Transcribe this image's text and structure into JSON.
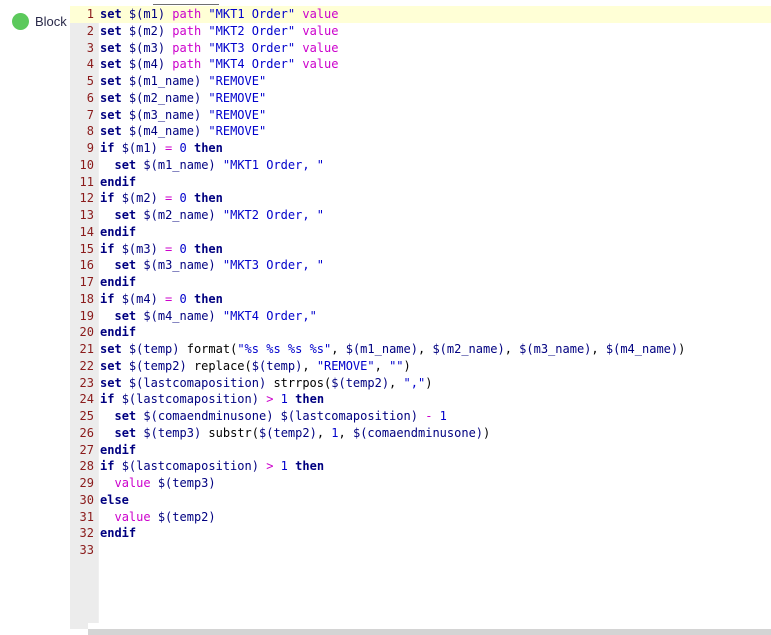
{
  "sidebar": {
    "status_dot_color": "#5cc95c",
    "status_dot_icon": "green-circle-icon",
    "label": "Block"
  },
  "editor": {
    "language": "scripting",
    "highlighted_line": 1,
    "total_lines": 33,
    "gutter_background": "#ececec",
    "line_number_color": "#8a1a1a",
    "highlight_color": "#ffffd6",
    "colors": {
      "keyword": "#000080",
      "function": "#cc00cc",
      "string": "#0000cc",
      "number": "#0000cc",
      "variable": "#000080",
      "operator": "#cc00cc"
    },
    "lines": [
      {
        "n": "1",
        "text": "set $(m1) path \"MKT1 Order\" value"
      },
      {
        "n": "2",
        "text": "set $(m2) path \"MKT2 Order\" value"
      },
      {
        "n": "3",
        "text": "set $(m3) path \"MKT3 Order\" value"
      },
      {
        "n": "4",
        "text": "set $(m4) path \"MKT4 Order\" value"
      },
      {
        "n": "5",
        "text": "set $(m1_name) \"REMOVE\""
      },
      {
        "n": "6",
        "text": "set $(m2_name) \"REMOVE\""
      },
      {
        "n": "7",
        "text": "set $(m3_name) \"REMOVE\""
      },
      {
        "n": "8",
        "text": "set $(m4_name) \"REMOVE\""
      },
      {
        "n": "9",
        "text": "if $(m1) = 0 then"
      },
      {
        "n": "10",
        "text": "  set $(m1_name) \"MKT1 Order, \""
      },
      {
        "n": "11",
        "text": "endif"
      },
      {
        "n": "12",
        "text": "if $(m2) = 0 then"
      },
      {
        "n": "13",
        "text": "  set $(m2_name) \"MKT2 Order, \""
      },
      {
        "n": "14",
        "text": "endif"
      },
      {
        "n": "15",
        "text": "if $(m3) = 0 then"
      },
      {
        "n": "16",
        "text": "  set $(m3_name) \"MKT3 Order, \""
      },
      {
        "n": "17",
        "text": "endif"
      },
      {
        "n": "18",
        "text": "if $(m4) = 0 then"
      },
      {
        "n": "19",
        "text": "  set $(m4_name) \"MKT4 Order,\""
      },
      {
        "n": "20",
        "text": "endif"
      },
      {
        "n": "21",
        "text": "set $(temp) format(\"%s %s %s %s\", $(m1_name), $(m2_name), $(m3_name), $(m4_name))"
      },
      {
        "n": "22",
        "text": "set $(temp2) replace($(temp), \"REMOVE\", \"\")"
      },
      {
        "n": "23",
        "text": "set $(lastcomaposition) strrpos($(temp2), \",\")"
      },
      {
        "n": "24",
        "text": "if $(lastcomaposition) > 1 then"
      },
      {
        "n": "25",
        "text": "  set $(comaendminusone) $(lastcomaposition) - 1"
      },
      {
        "n": "26",
        "text": "  set $(temp3) substr($(temp2), 1, $(comaendminusone))"
      },
      {
        "n": "27",
        "text": "endif"
      },
      {
        "n": "28",
        "text": "if $(lastcomaposition) > 1 then"
      },
      {
        "n": "29",
        "text": "  value $(temp3)"
      },
      {
        "n": "30",
        "text": "else"
      },
      {
        "n": "31",
        "text": "  value $(temp2)"
      },
      {
        "n": "32",
        "text": "endif"
      },
      {
        "n": "33",
        "text": ""
      }
    ]
  },
  "scrollbar": {
    "horizontal_position": "0",
    "track_color": "#d4d4d4"
  }
}
